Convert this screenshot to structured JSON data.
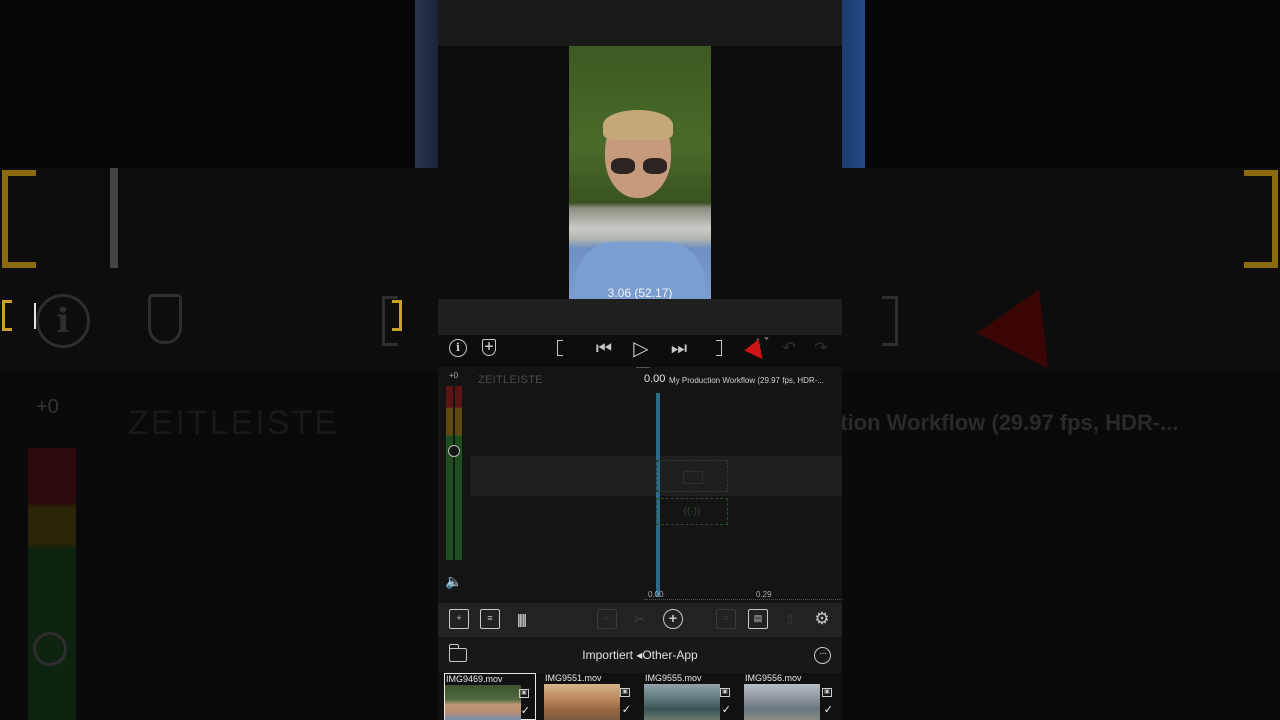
{
  "viewer": {
    "timecode": "3.06 (52.17)"
  },
  "transport": {
    "info_icon": "info-icon",
    "marker_icon": "add-marker-icon",
    "mode_glyph": "⇣ˇ"
  },
  "timeline": {
    "meter_label": "+0",
    "title": "ZEITLEISTE",
    "playhead_time": "0.00",
    "project_name": "My Production Workflow (29.97 fps, HDR-...",
    "ruler_start": "0.00",
    "ruler_mark": "0.29"
  },
  "browser": {
    "title": "Importiert ◂Other-App",
    "clips": [
      {
        "name": "IMG9469.mov"
      },
      {
        "name": "IMG9551.mov"
      },
      {
        "name": "IMG9555.mov"
      },
      {
        "name": "IMG9556.mov"
      }
    ]
  },
  "background": {
    "zoom_title": "ZEITLEISTE",
    "zoom_project": "ction Workflow (29.97 fps, HDR-...",
    "zoom_meter_label": "+0"
  },
  "colors": {
    "trim_accent": "#c9a227",
    "playhead": "#2c6a8a",
    "cursor": "#d01414"
  }
}
